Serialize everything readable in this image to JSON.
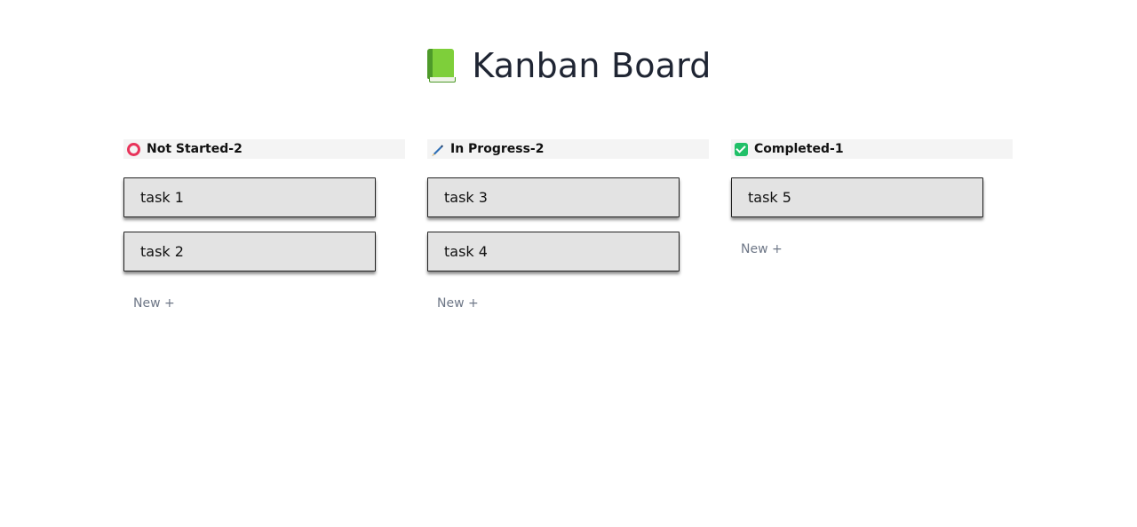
{
  "header": {
    "title": "Kanban Board",
    "icon": "green-book-icon"
  },
  "columns": [
    {
      "title": "Not Started",
      "separator": "-",
      "count": "2",
      "icon": "red-circle-icon",
      "cards": [
        {
          "label": "task 1"
        },
        {
          "label": "task 2"
        }
      ],
      "new_label": "New +"
    },
    {
      "title": "In Progress",
      "separator": "-",
      "count": "2",
      "icon": "pen-icon",
      "cards": [
        {
          "label": "task 3"
        },
        {
          "label": "task 4"
        }
      ],
      "new_label": "New +"
    },
    {
      "title": "Completed",
      "separator": "-",
      "count": "1",
      "icon": "check-box-icon",
      "cards": [
        {
          "label": "task 5"
        }
      ],
      "new_label": "New +"
    }
  ],
  "colors": {
    "title_text": "#1f2533",
    "column_header_bg": "#f4f4f4",
    "card_bg": "#e3e3e3",
    "new_button_text": "#6e7787",
    "not_started_icon": "#e8345b",
    "completed_icon": "#21c068"
  }
}
